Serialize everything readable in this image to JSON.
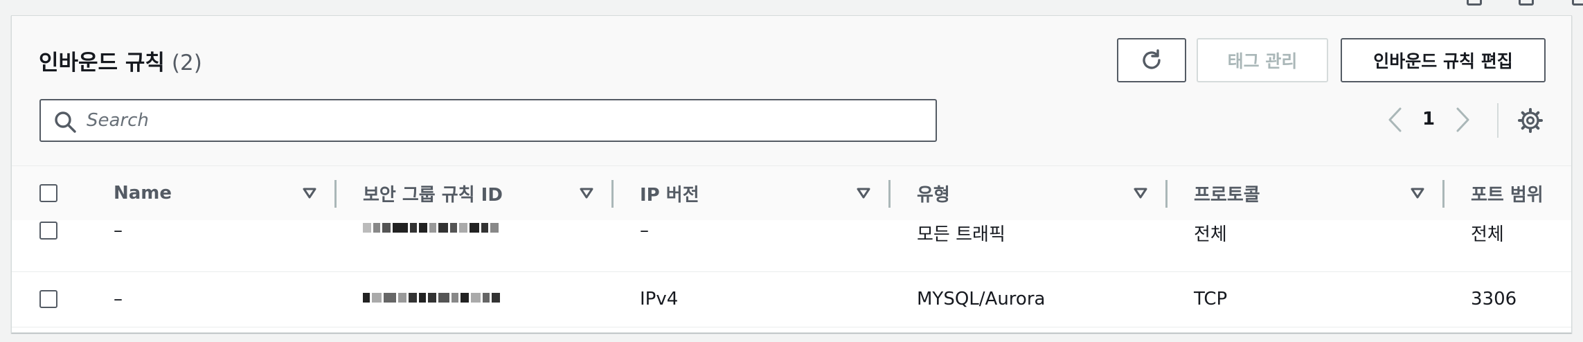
{
  "page": {
    "title": "인바운드 규칙",
    "count": "(2)",
    "buttons": {
      "manage_tags": "태그 관리",
      "edit_inbound_rules": "인바운드 규칙 편집"
    },
    "search": {
      "placeholder": "Search"
    },
    "pagination": {
      "current_page": "1"
    }
  },
  "table": {
    "columns": [
      "Name",
      "보안 그룹 규칙 ID",
      "IP 버전",
      "유형",
      "프로토콜",
      "포트 범위"
    ],
    "rows": [
      {
        "name": "–",
        "rule_id": "",
        "ip_version": "–",
        "type": "모든 트래픽",
        "protocol": "전체",
        "port_range": "전체"
      },
      {
        "name": "–",
        "rule_id": "",
        "ip_version": "IPv4",
        "type": "MYSQL/Aurora",
        "protocol": "TCP",
        "port_range": "3306"
      }
    ]
  },
  "colors": {
    "text_primary": "#16191f",
    "text_secondary": "#545b64",
    "disabled": "#aab7b8",
    "border": "#d5dbdb",
    "background": "#f2f3f3"
  }
}
